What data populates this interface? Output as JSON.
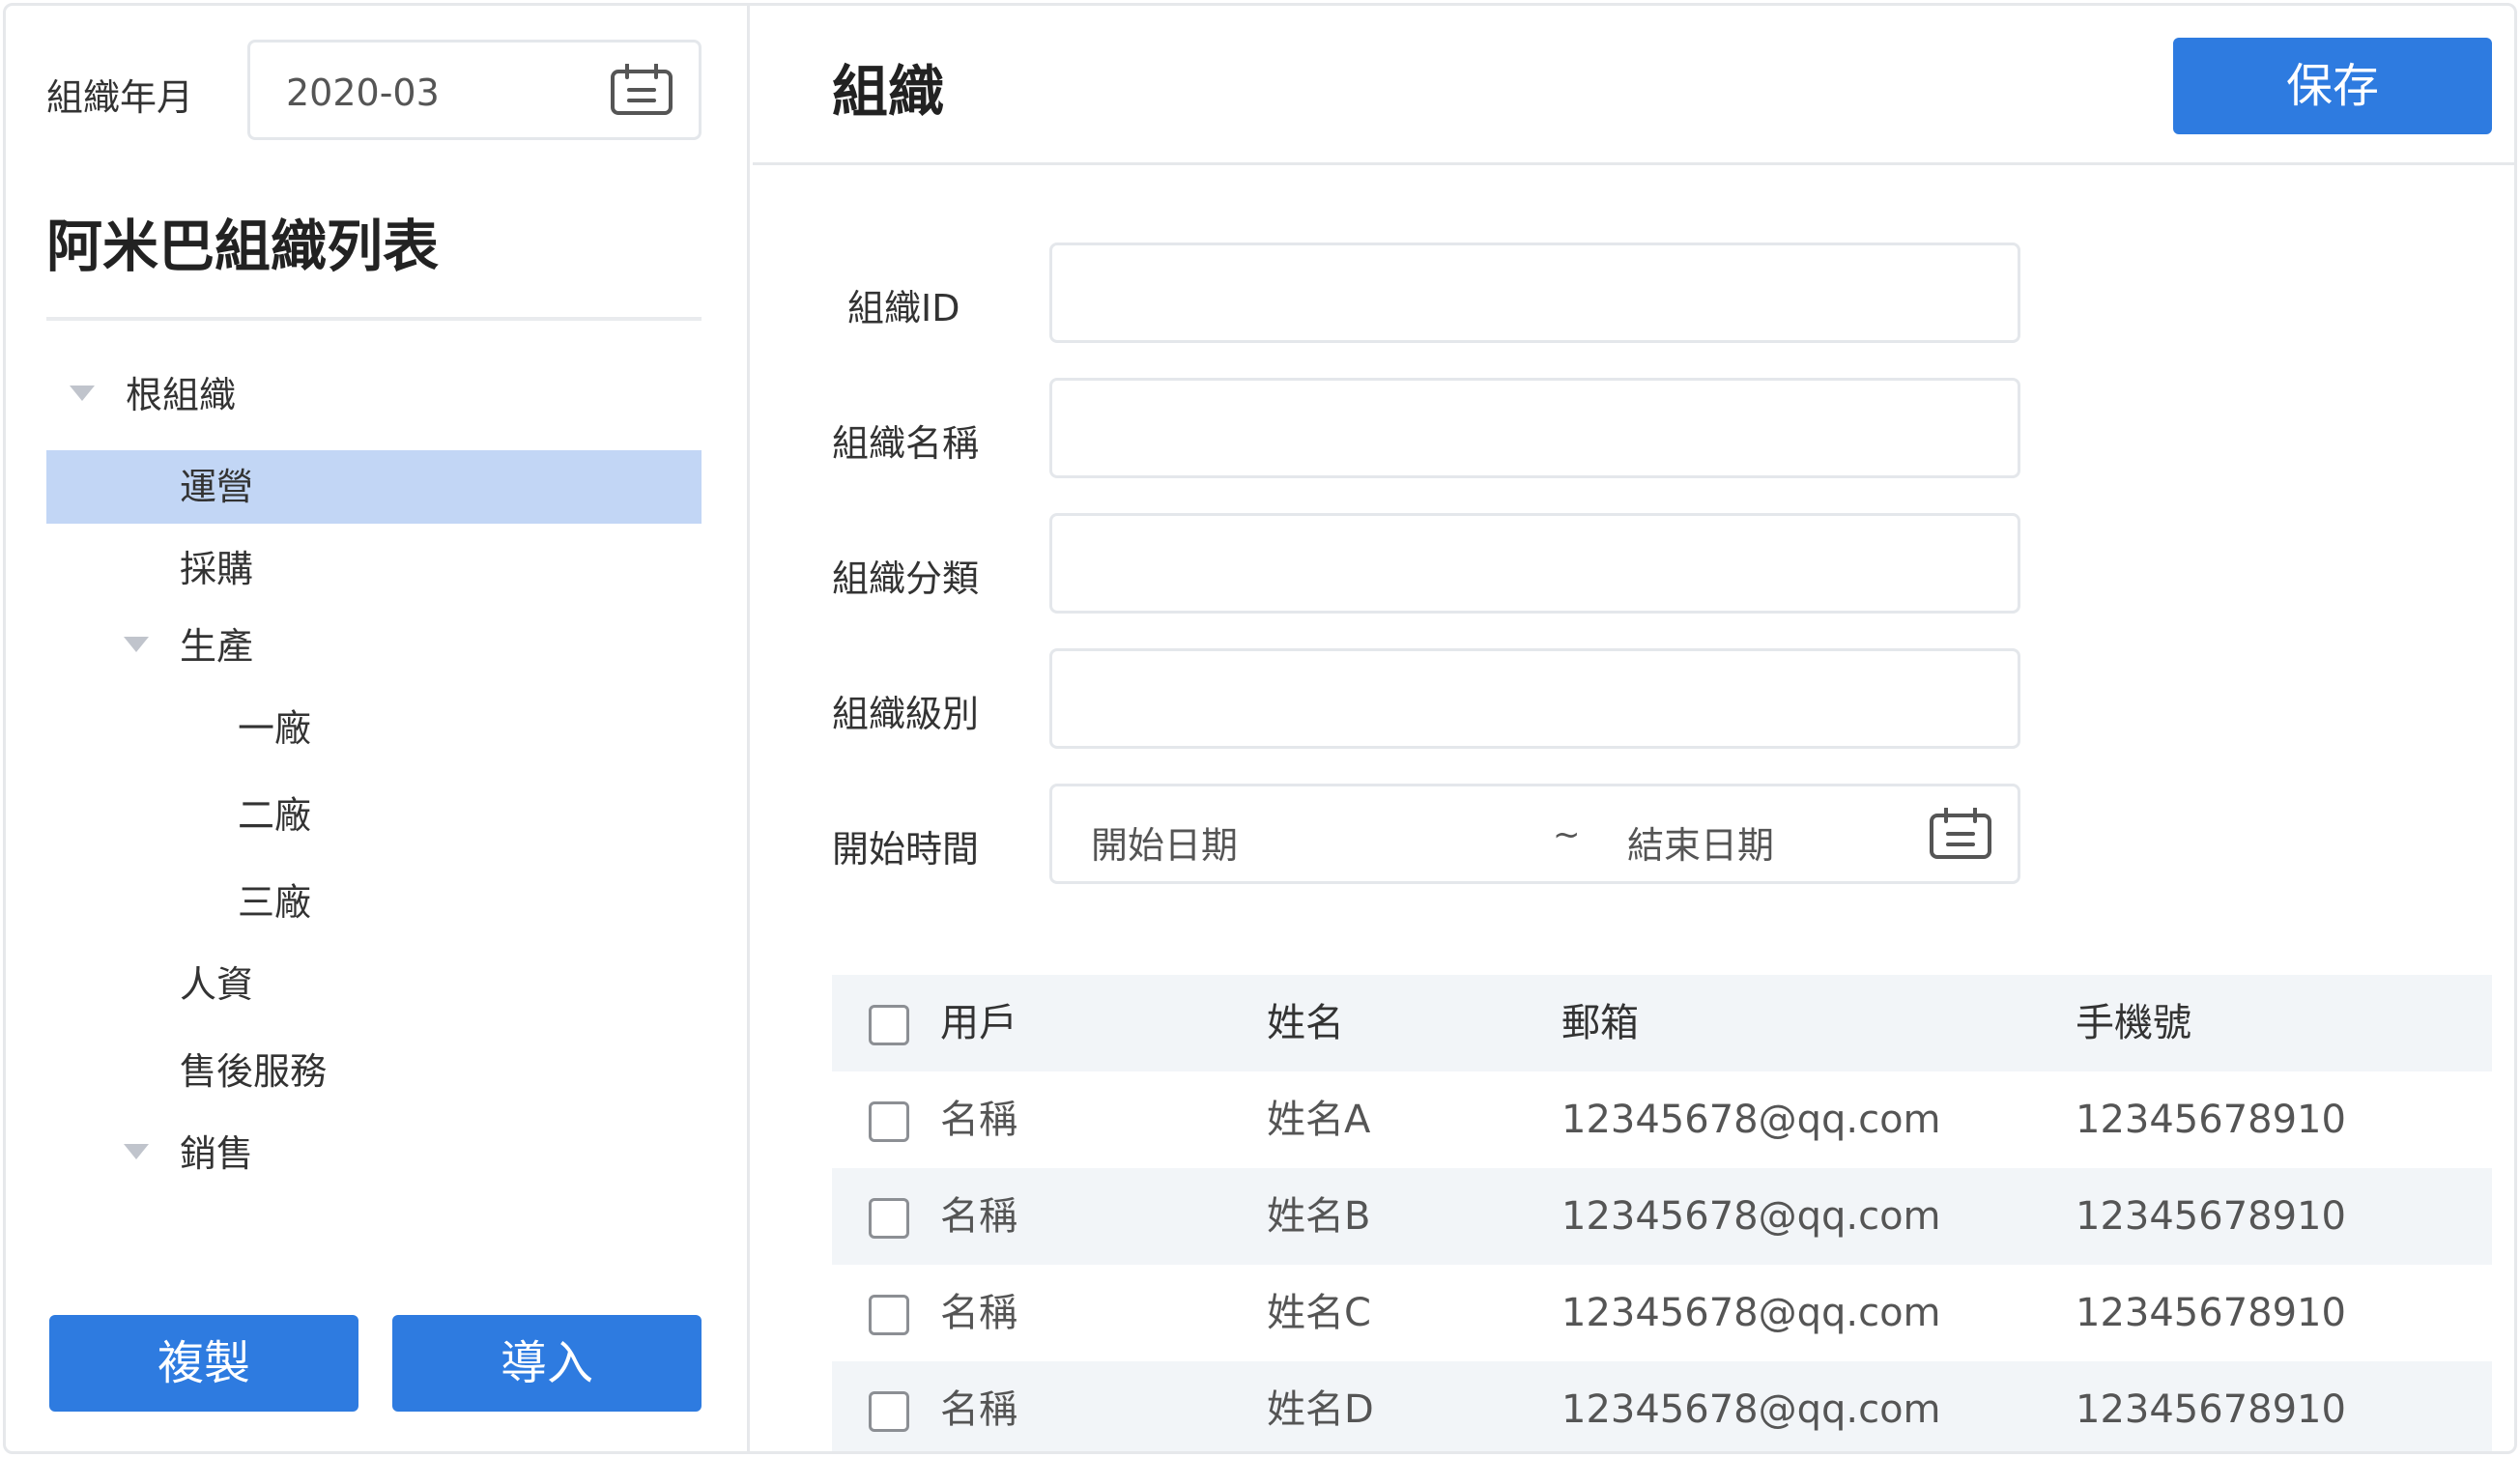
{
  "sidebar": {
    "year_month_label": "組織年月",
    "year_month_value": "2020-03",
    "title": "阿米巴組織列表",
    "tree": [
      {
        "label": "根組織",
        "expanded": true,
        "depth": 0,
        "selected": false
      },
      {
        "label": "運營",
        "expanded": false,
        "depth": 1,
        "selected": true
      },
      {
        "label": "採購",
        "expanded": false,
        "depth": 1,
        "selected": false
      },
      {
        "label": "生產",
        "expanded": true,
        "depth": 1,
        "selected": false
      },
      {
        "label": "一廠",
        "expanded": false,
        "depth": 2,
        "selected": false
      },
      {
        "label": "二廠",
        "expanded": false,
        "depth": 2,
        "selected": false
      },
      {
        "label": "三廠",
        "expanded": false,
        "depth": 2,
        "selected": false
      },
      {
        "label": "人資",
        "expanded": false,
        "depth": 1,
        "selected": false
      },
      {
        "label": "售後服務",
        "expanded": false,
        "depth": 1,
        "selected": false
      },
      {
        "label": "銷售",
        "expanded": true,
        "depth": 1,
        "selected": false
      }
    ],
    "copy_label": "複製",
    "import_label": "導入"
  },
  "main": {
    "title": "組織",
    "save_label": "保存",
    "form": {
      "org_id_label": "組織ID",
      "org_name_label": "組織名稱",
      "org_category_label": "組織分類",
      "org_level_label": "組織級別",
      "start_time_label": "開始時間",
      "start_date_placeholder": "開始日期",
      "range_separator": "~",
      "end_date_placeholder": "結束日期"
    },
    "table": {
      "headers": [
        "用戶",
        "姓名",
        "郵箱",
        "手機號"
      ],
      "rows": [
        {
          "user": "名稱",
          "name": "姓名A",
          "email": "12345678@qq.com",
          "phone": "12345678910"
        },
        {
          "user": "名稱",
          "name": "姓名B",
          "email": "12345678@qq.com",
          "phone": "12345678910"
        },
        {
          "user": "名稱",
          "name": "姓名C",
          "email": "12345678@qq.com",
          "phone": "12345678910"
        },
        {
          "user": "名稱",
          "name": "姓名D",
          "email": "12345678@qq.com",
          "phone": "12345678910"
        }
      ]
    }
  },
  "colors": {
    "accent": "#2e7be0",
    "selected_row": "#c2d6f5",
    "table_stripe": "#f2f5f8",
    "border": "#e4e7eb"
  },
  "icons": {
    "calendar": "calendar-icon",
    "expand": "caret-down-icon",
    "checkbox": "checkbox-icon"
  }
}
